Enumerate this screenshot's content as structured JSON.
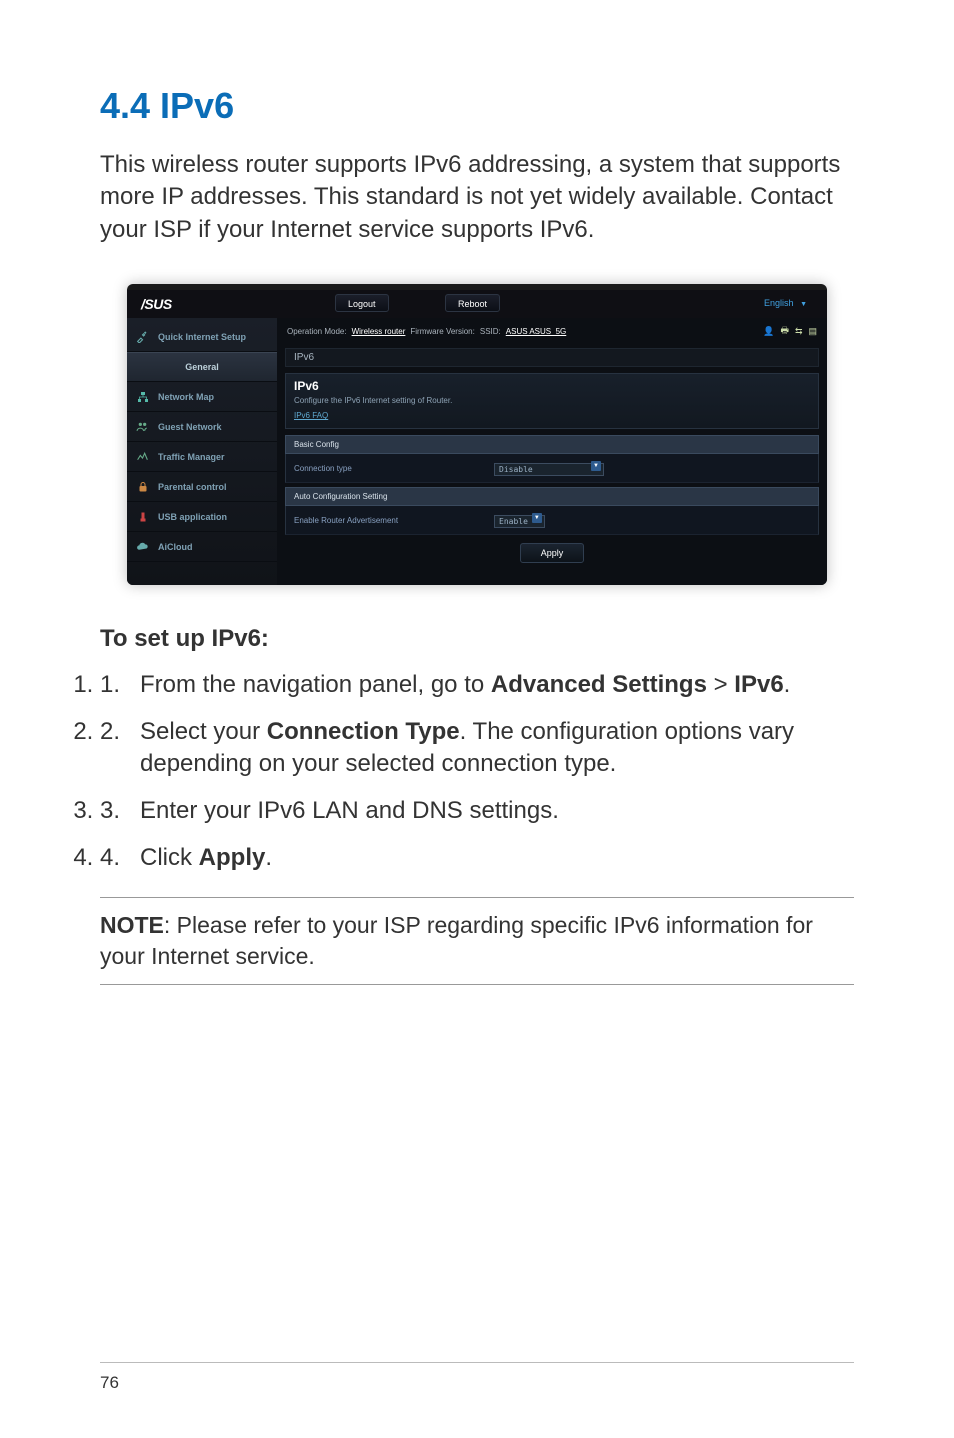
{
  "heading": "4.4   IPv6",
  "intro": "This wireless router supports IPv6 addressing, a system that supports more IP addresses. This standard is not yet widely available. Contact your ISP if your Internet service supports IPv6.",
  "screenshot": {
    "logo": "/SUS",
    "logout_btn": "Logout",
    "reboot_btn": "Reboot",
    "language": "English",
    "info_bar": {
      "op_mode_label": "Operation Mode:",
      "op_mode_value": "Wireless router",
      "fw_label": "Firmware Version:",
      "ssid_label": "SSID:",
      "ssid_value": "ASUS  ASUS_5G"
    },
    "breadcrumb": "IPv6",
    "sidebar": {
      "qis": "Quick Internet Setup",
      "general": "General",
      "network_map": "Network Map",
      "guest_network": "Guest Network",
      "traffic_manager": "Traffic Manager",
      "parental_control": "Parental control",
      "usb_app": "USB application",
      "aicloud": "AiCloud"
    },
    "panel": {
      "title": "IPv6",
      "subtitle": "Configure the IPv6 Internet setting of Router.",
      "faq": "IPv6 FAQ"
    },
    "basic_config": {
      "header": "Basic Config",
      "conn_type_label": "Connection type",
      "conn_type_value": "Disable"
    },
    "auto_config": {
      "header": "Auto Configuration Setting",
      "enable_label": "Enable Router Advertisement",
      "enable_value": "Enable"
    },
    "apply_btn": "Apply"
  },
  "instructions": {
    "heading": "To set up IPv6:",
    "steps": {
      "s1_a": "From the navigation panel, go to ",
      "s1_b": "Advanced Settings",
      "s1_c": " > ",
      "s1_d": "IPv6",
      "s1_e": ".",
      "s2_a": "Select your ",
      "s2_b": "Connection Type",
      "s2_c": ". The configuration options vary depending on your selected connection type.",
      "s3": "Enter your IPv6 LAN and DNS settings.",
      "s4_a": "Click ",
      "s4_b": "Apply",
      "s4_c": "."
    }
  },
  "note": {
    "label": "NOTE",
    "text": ": Please refer to your ISP regarding specific IPv6 information for your Internet service."
  },
  "page_number": "76"
}
